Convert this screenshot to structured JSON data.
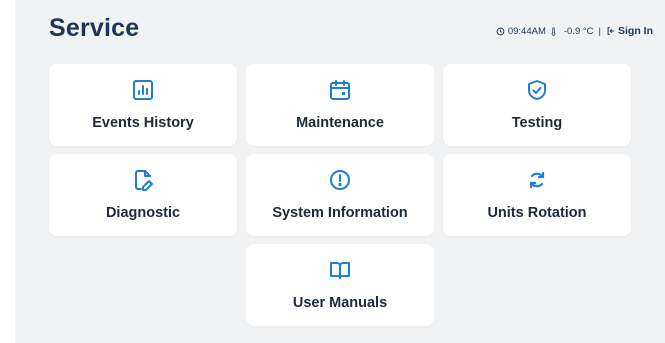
{
  "page": {
    "title": "Service"
  },
  "status": {
    "time": "09:44AM",
    "temperature": "-0.9 °C",
    "separator": "|",
    "sign_in_label": "Sign In"
  },
  "colors": {
    "accent": "#1f7fd6",
    "title": "#1d3557",
    "panel": "#f1f2f4"
  },
  "cards": [
    {
      "label": "Events History",
      "icon": "bar-chart-icon"
    },
    {
      "label": "Maintenance",
      "icon": "calendar-icon"
    },
    {
      "label": "Testing",
      "icon": "shield-check-icon"
    },
    {
      "label": "Diagnostic",
      "icon": "file-edit-icon"
    },
    {
      "label": "System Information",
      "icon": "alert-circle-icon"
    },
    {
      "label": "Units Rotation",
      "icon": "rotate-icon"
    },
    {
      "label": "User Manuals",
      "icon": "book-open-icon"
    }
  ]
}
